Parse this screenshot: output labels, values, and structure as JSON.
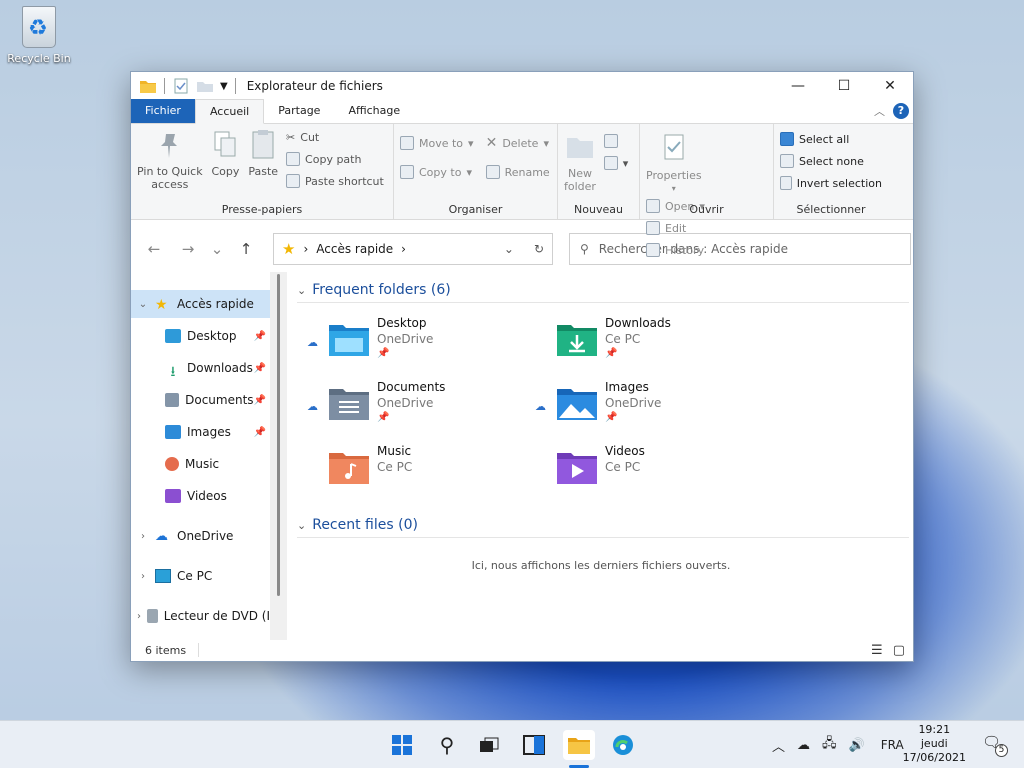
{
  "desktop": {
    "recycle_bin_label": "Recycle Bin"
  },
  "window": {
    "title": "Explorateur de fichiers",
    "controls": {
      "minimize": "—",
      "maximize": "☐",
      "close": "✕"
    }
  },
  "ribbon_tabs": [
    "Fichier",
    "Accueil",
    "Partage",
    "Affichage"
  ],
  "ribbon": {
    "clipboard": {
      "pin": "Pin to Quick access",
      "pin_l1": "Pin to Quick",
      "pin_l2": "access",
      "copy": "Copy",
      "paste": "Paste",
      "cut": "Cut",
      "copy_path": "Copy path",
      "paste_shortcut": "Paste shortcut",
      "label": "Presse-papiers"
    },
    "organize": {
      "move_to": "Move to",
      "copy_to": "Copy to",
      "delete": "Delete",
      "rename": "Rename",
      "label": "Organiser"
    },
    "new": {
      "new_folder_l1": "New",
      "new_folder_l2": "folder",
      "label": "Nouveau"
    },
    "open": {
      "properties": "Properties",
      "open": "Open",
      "edit": "Edit",
      "history": "History",
      "label": "Ouvrir"
    },
    "select": {
      "select_all": "Select all",
      "select_none": "Select none",
      "invert": "Invert selection",
      "label": "Sélectionner"
    }
  },
  "navigation": {
    "back": "←",
    "forward": "→",
    "recent": "⌄",
    "up": "↑",
    "breadcrumb": "Accès rapide",
    "search_placeholder": "Rechercher dans : Accès rapide"
  },
  "sidebar": {
    "quick_access": "Accès rapide",
    "items": [
      {
        "label": "Desktop",
        "pinned": true
      },
      {
        "label": "Downloads",
        "pinned": true
      },
      {
        "label": "Documents",
        "pinned": true
      },
      {
        "label": "Images",
        "pinned": true
      },
      {
        "label": "Music",
        "pinned": false
      },
      {
        "label": "Videos",
        "pinned": false
      }
    ],
    "onedrive": "OneDrive",
    "this_pc": "Ce PC",
    "dvd": "Lecteur de DVD (I"
  },
  "main": {
    "frequent_title": "Frequent folders (6)",
    "folders": [
      {
        "name": "Desktop",
        "location": "OneDrive",
        "cloud": true,
        "pinned": true
      },
      {
        "name": "Downloads",
        "location": "Ce PC",
        "cloud": false,
        "pinned": true
      },
      {
        "name": "Documents",
        "location": "OneDrive",
        "cloud": true,
        "pinned": true
      },
      {
        "name": "Images",
        "location": "OneDrive",
        "cloud": true,
        "pinned": true
      },
      {
        "name": "Music",
        "location": "Ce PC",
        "cloud": false,
        "pinned": false
      },
      {
        "name": "Videos",
        "location": "Ce PC",
        "cloud": false,
        "pinned": false
      }
    ],
    "recent_title": "Recent files (0)",
    "recent_empty": "Ici, nous affichons les derniers fichiers ouverts."
  },
  "status": {
    "items": "6 items"
  },
  "taskbar": {
    "language": "FRA",
    "time": "19:21",
    "day": "jeudi",
    "date": "17/06/2021",
    "notifications": "5"
  },
  "colors": {
    "accent": "#1d64b8",
    "selection": "#cde3f7",
    "section_title": "#1c4f9c"
  }
}
